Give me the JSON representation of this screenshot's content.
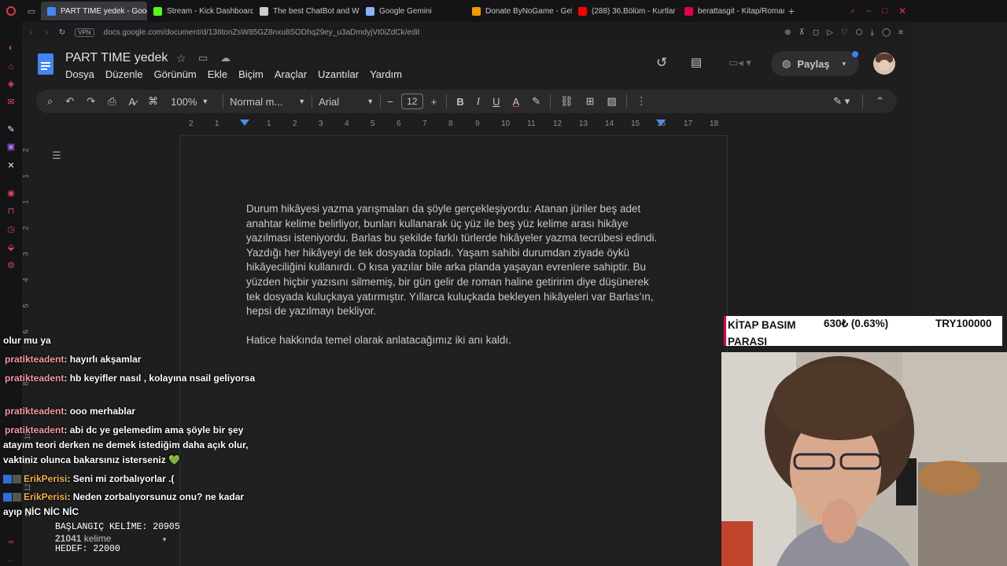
{
  "browser": {
    "tabs": [
      {
        "label": "PART TIME yedek - Goog",
        "active": true,
        "color": "#4285f4"
      },
      {
        "label": "Stream - Kick Dashboard",
        "active": false,
        "color": "#53fc18"
      },
      {
        "label": "The best ChatBot and W",
        "active": false,
        "color": "#cccccc"
      },
      {
        "label": "Google Gemini",
        "active": false,
        "color": "#8ab4f8"
      },
      {
        "label": "Donate ByNoGame - Gele",
        "active": false,
        "color": "#f29900"
      },
      {
        "label": "(288) 36.Bölüm - Kurtlar V",
        "active": false,
        "color": "#ff0000"
      },
      {
        "label": "berattasgit - Kitap/Roman",
        "active": false,
        "color": "#e0004d"
      }
    ],
    "vpn": "VPN",
    "url": "docs.google.com/document/d/136tonZsW85GZ8nxu8SODhq29ey_u3aDmdyjVt0iZdCk/edit"
  },
  "doc": {
    "title": "PART TIME  yedek",
    "menu": [
      "Dosya",
      "Düzenle",
      "Görünüm",
      "Ekle",
      "Biçim",
      "Araçlar",
      "Uzantılar",
      "Yardım"
    ],
    "share_label": "Paylaş",
    "zoom": "100%",
    "style": "Normal m...",
    "font": "Arial",
    "font_size": "12",
    "ruler_ticks": [
      "2",
      "1",
      "1",
      "2",
      "3",
      "4",
      "5",
      "6",
      "7",
      "8",
      "9",
      "10",
      "11",
      "12",
      "13",
      "14",
      "15",
      "16",
      "17",
      "18"
    ],
    "vruler_ticks": [
      "2",
      "1",
      "1",
      "2",
      "3",
      "4",
      "5",
      "6",
      "7",
      "8",
      "9",
      "10",
      "11",
      "12",
      "13"
    ],
    "paragraph1": "Durum hikâyesi yazma yarışmaları da şöyle gerçekleşiyordu: Atanan jüriler beş adet anahtar kelime belirliyor, bunları kullanarak üç yüz ile beş yüz kelime arası hikâye yazılması isteniyordu. Barlas bu şekilde farklı türlerde hikâyeler yazma tecrübesi edindi. Yazdığı her hikâyeyi de tek dosyada topladı. Yaşam sahibi durumdan ziyade öykü hikâyeciliğini kullanırdı. O kısa yazılar bile arka planda yaşayan evrenlere sahiptir. Bu yüzden hiçbir yazısını silmemiş, bir gün gelir de roman haline getiririm diye düşünerek tek dosyada kuluçkaya yatırmıştır. Yıllarca kuluçkada bekleyen hikâyeleri var Barlas’ın, hepsi de yazılmayı bekliyor.",
    "paragraph2": "Hatice hakkında temel olarak anlatacağımız iki anı kaldı.",
    "word_count": "21041",
    "word_count_label": "kelime"
  },
  "chat": {
    "messages": [
      {
        "user": "",
        "text": "olur mu ya",
        "badges": false
      },
      {
        "user": "pratikteadent",
        "text": ": hayırlı akşamlar",
        "badges": false
      },
      {
        "user": "pratikteadent",
        "text": ": hb keyifler nasıl , kolayına nsail geliyorsa",
        "badges": false
      },
      {
        "user": "pratikteadent",
        "text": ": ooo merhablar",
        "badges": false
      },
      {
        "user": "pratikteadent",
        "text": ": abi dc ye gelemedim ama şöyle bir şey atayım teori derken ne demek istediğim daha açık olur, vaktiniz olunca bakarsınız isterseniz 💚",
        "badges": false
      },
      {
        "user": "ErikPerisi",
        "text": ": Seni mi zorbalıyorlar .(",
        "badges": true
      },
      {
        "user": "ErikPerisi",
        "text": ": Neden zorbalıyorsunuz onu? ne kadar ayıp NİC NİC NİC",
        "badges": true
      }
    ]
  },
  "overlay": {
    "start_label": "BAŞLANGIÇ KELİME: 20905",
    "target_label": "HEDEF: 22000"
  },
  "stock": {
    "name": "KİTAP BASIM PARASI",
    "change": "630₺ (0.63%)",
    "goal": "TRY100000"
  }
}
